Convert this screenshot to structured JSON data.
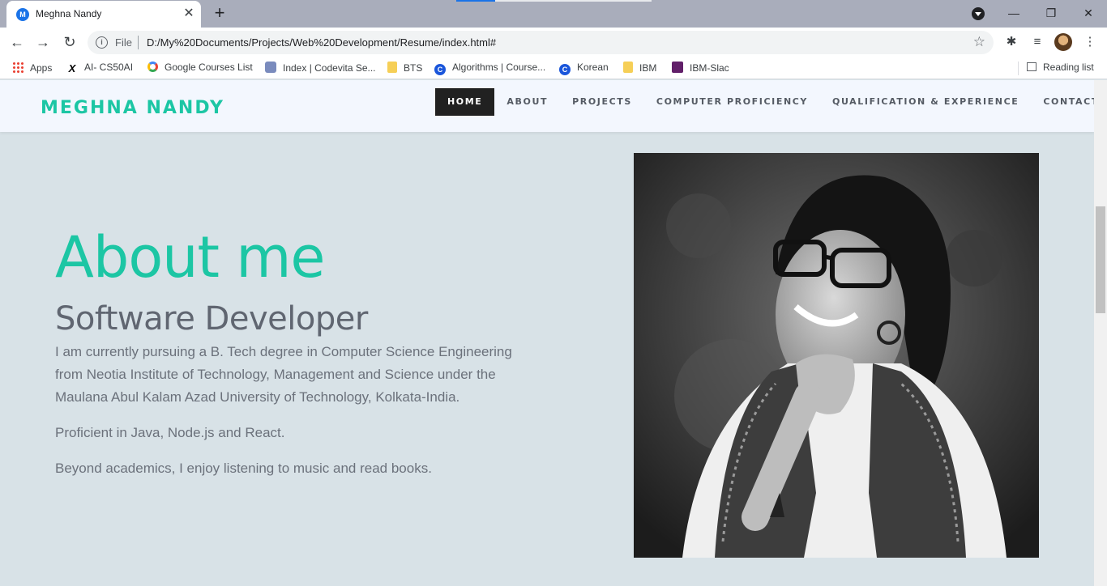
{
  "browser": {
    "tab_title": "Meghna Nandy",
    "tab_favicon_letter": "M",
    "tab_close": "✕",
    "new_tab": "+",
    "window_controls": {
      "minimize": "—",
      "restore": "❐",
      "close": "✕"
    },
    "nav": {
      "back": "←",
      "forward": "→",
      "reload": "↻"
    },
    "address": {
      "scheme_label": "File",
      "url": "D:/My%20Documents/Projects/Web%20Development/Resume/index.html#",
      "star": "☆"
    },
    "bookmarks": [
      {
        "label": "Apps",
        "icon": "apps-grid-icon"
      },
      {
        "label": "AI- CS50AI",
        "icon": "x-logo-icon"
      },
      {
        "label": "Google Courses List",
        "icon": "google-icon"
      },
      {
        "label": "Index | Codevita Se...",
        "icon": "codevita-icon"
      },
      {
        "label": "BTS",
        "icon": "folder-icon"
      },
      {
        "label": "Algorithms | Course...",
        "icon": "coursera-icon"
      },
      {
        "label": "Korean",
        "icon": "coursera-icon"
      },
      {
        "label": "IBM",
        "icon": "folder-icon"
      },
      {
        "label": "IBM-Slac",
        "icon": "slack-icon"
      }
    ],
    "reading_list": "Reading list"
  },
  "site": {
    "brand": "MEGHNA NANDY",
    "menu": [
      {
        "label": "HOME",
        "active": true
      },
      {
        "label": "ABOUT",
        "active": false
      },
      {
        "label": "PROJECTS",
        "active": false
      },
      {
        "label": "COMPUTER PROFICIENCY",
        "active": false
      },
      {
        "label": "QUALIFICATION & EXPERIENCE",
        "active": false
      },
      {
        "label": "CONTACT",
        "active": false
      }
    ],
    "about": {
      "title": "About me",
      "subtitle": "Software Developer",
      "paragraphs": [
        "I am currently pursuing a B. Tech degree in Computer Science Engineering from Neotia Institute of Technology, Management and Science under the Maulana Abul Kalam Azad University of Technology, Kolkata-India.",
        "Proficient in Java, Node.js and React.",
        "Beyond academics, I enjoy listening to music and read books."
      ]
    }
  },
  "colors": {
    "accent": "#1cc6a4",
    "page_bg": "#d8e2e7",
    "nav_bg": "#f3f7fe",
    "active_menu_bg": "#212121"
  }
}
